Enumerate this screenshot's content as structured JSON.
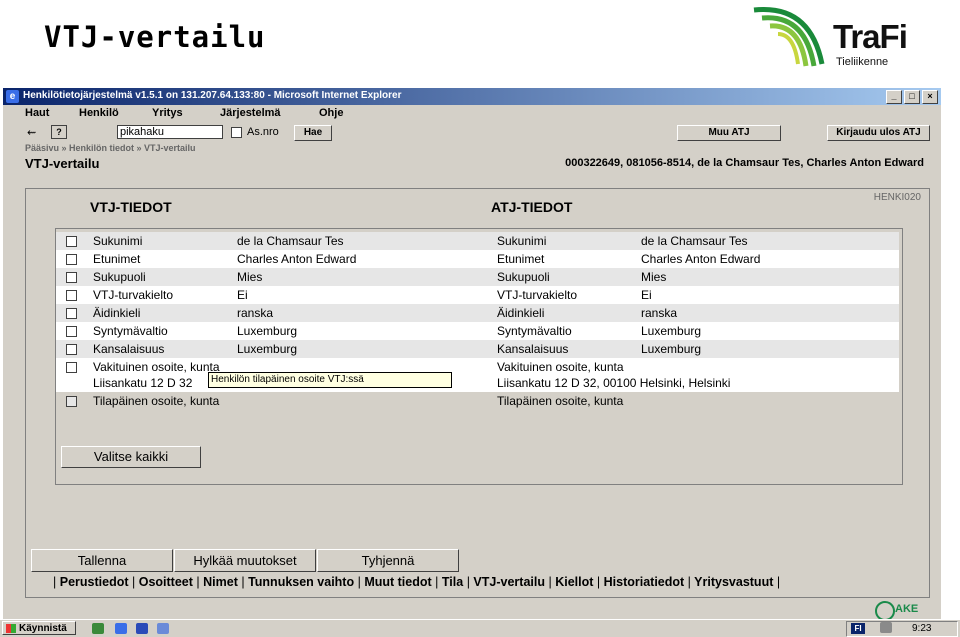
{
  "slide": {
    "title": "VTJ-vertailu",
    "logo_text": "TraFi",
    "logo_sub": "Tieliikenne"
  },
  "window": {
    "title": "Henkilötietojärjestelmä v1.5.1 on 131.207.64.133:80 - Microsoft Internet Explorer",
    "controls": [
      "_",
      "□",
      "×"
    ]
  },
  "menu": [
    "Haut",
    "Henkilö",
    "Yritys",
    "Järjestelmä",
    "Ohje"
  ],
  "toolbar": {
    "search_value": "pikahaku",
    "asnro_label": "As.nro",
    "search_button": "Hae",
    "muu_atj_button": "Muu ATJ",
    "logout_button": "Kirjaudu ulos ATJ",
    "help_icon": "?"
  },
  "breadcrumb": "Pääsivu » Henkilön tiedot » VTJ-vertailu",
  "page_heading": "VTJ-vertailu",
  "person_info": "000322649, 081056-8514, de la Chamsaur Tes, Charles Anton Edward",
  "panel": {
    "code": "HENKI020",
    "vtj_title": "VTJ-TIEDOT",
    "atj_title": "ATJ-TIEDOT"
  },
  "rows": [
    {
      "vtj_label": "Sukunimi",
      "vtj_value": "de la Chamsaur Tes",
      "atj_label": "Sukunimi",
      "atj_value": "de la Chamsaur Tes"
    },
    {
      "vtj_label": "Etunimet",
      "vtj_value": "Charles Anton Edward",
      "atj_label": "Etunimet",
      "atj_value": "Charles Anton Edward"
    },
    {
      "vtj_label": "Sukupuoli",
      "vtj_value": "Mies",
      "atj_label": "Sukupuoli",
      "atj_value": "Mies"
    },
    {
      "vtj_label": "VTJ-turvakielto",
      "vtj_value": "Ei",
      "atj_label": "VTJ-turvakielto",
      "atj_value": "Ei"
    },
    {
      "vtj_label": "Äidinkieli",
      "vtj_value": "ranska",
      "atj_label": "Äidinkieli",
      "atj_value": "ranska"
    },
    {
      "vtj_label": "Syntymävaltio",
      "vtj_value": "Luxemburg",
      "atj_label": "Syntymävaltio",
      "atj_value": "Luxemburg"
    },
    {
      "vtj_label": "Kansalaisuus",
      "vtj_value": "Luxemburg",
      "atj_label": "Kansalaisuus",
      "atj_value": "Luxemburg"
    }
  ],
  "address_row": {
    "vtj_label": "Vakituinen osoite, kunta",
    "vtj_value": "Liisankatu 12 D 32",
    "atj_label": "Vakituinen osoite, kunta",
    "atj_value": "Liisankatu 12 D 32, 00100 Helsinki, Helsinki"
  },
  "tooltip": "Henkilön tilapäinen osoite VTJ:ssä",
  "temp_row": {
    "vtj_label": "Tilapäinen osoite, kunta",
    "atj_label": "Tilapäinen osoite, kunta"
  },
  "select_all": "Valitse kaikki",
  "actions": {
    "save": "Tallenna",
    "reject": "Hylkää muutokset",
    "clear": "Tyhjennä"
  },
  "nav_links": [
    "Perustiedot",
    "Osoitteet",
    "Nimet",
    "Tunnuksen vaihto",
    "Muut tiedot",
    "Tila",
    "VTJ-vertailu",
    "Kiellot",
    "Historiatiedot",
    "Yritysvastuut"
  ],
  "ake": "AKE",
  "taskbar": {
    "start": "Käynnistä",
    "lang": "FI",
    "clock": "9:23"
  }
}
